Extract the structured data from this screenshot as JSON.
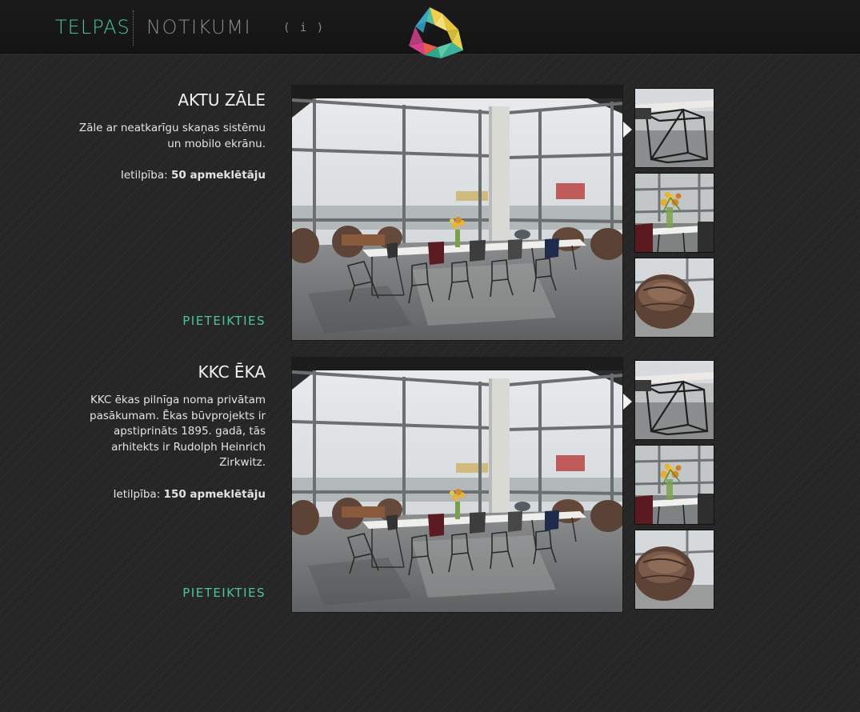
{
  "nav": {
    "active_label": "TELPAS",
    "events_label": "NOTIKUMI",
    "info_label": "( i )"
  },
  "spaces": [
    {
      "title": "AKTU ZĀLE",
      "description": "Zāle ar neatkarīgu skaņas sistēmu un mobilo ekrānu.",
      "capacity_label": "Ietilpība:",
      "capacity_value": "50 apmeklētāju",
      "apply_label": "PIETEIKTIES"
    },
    {
      "title": "KKC ĒKA",
      "description": "KKC ēkas pilnīga noma privātam pasākumam. Ēkas būvprojekts ir apstiprināts 1895. gadā, tās arhitekts ir Rudolph Heinrich Zirkwitz.",
      "capacity_label": "Ietilpība:",
      "capacity_value": "150 apmeklētāju",
      "apply_label": "PIETEIKTIES"
    }
  ],
  "colors": {
    "accent": "#4fc2a0",
    "background": "#262626",
    "topbar": "#161616"
  },
  "icons": {
    "logo": "triangle-logo-icon",
    "selected_thumb_indicator": "pointer-arrow-icon"
  }
}
